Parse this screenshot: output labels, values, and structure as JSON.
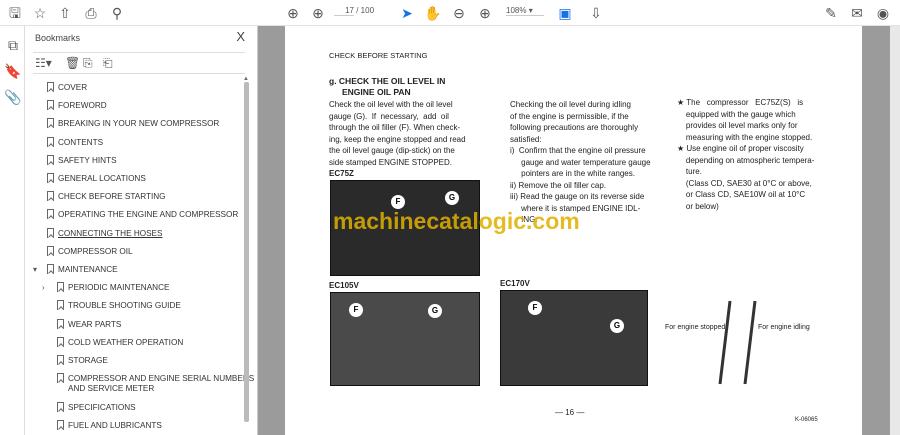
{
  "toolbar": {
    "page_current": "17",
    "page_total": "/ 100",
    "zoom": "108%"
  },
  "panel": {
    "title": "Bookmarks",
    "close": "X"
  },
  "bookmarks": [
    {
      "label": "COVER"
    },
    {
      "label": "FOREWORD"
    },
    {
      "label": "BREAKING IN YOUR NEW COMPRESSOR"
    },
    {
      "label": "CONTENTS"
    },
    {
      "label": "SAFETY HINTS"
    },
    {
      "label": "GENERAL LOCATIONS"
    },
    {
      "label": "CHECK BEFORE STARTING"
    },
    {
      "label": "OPERATING THE ENGINE AND COMPRESSOR"
    },
    {
      "label": "CONNECTING THE HOSES"
    },
    {
      "label": "COMPRESSOR OIL"
    },
    {
      "label": "MAINTENANCE"
    },
    {
      "label": "PERIODIC MAINTENANCE"
    },
    {
      "label": "TROUBLE SHOOTING GUIDE"
    },
    {
      "label": "WEAR PARTS"
    },
    {
      "label": "COLD WEATHER OPERATION"
    },
    {
      "label": "STORAGE"
    },
    {
      "label": "COMPRESSOR AND ENGINE SERIAL NUMBERS"
    },
    {
      "label": "AND SERVICE METER"
    },
    {
      "label": "SPECIFICATIONS"
    },
    {
      "label": "FUEL AND LUBRICANTS"
    }
  ],
  "doc": {
    "header": "CHECK BEFORE STARTING",
    "heading1": "g.  CHECK THE OIL LEVEL IN",
    "heading2": "ENGINE OIL PAN",
    "col1": [
      "Check the oil level with the oil level",
      "gauge (G).  If  necessary,  add  oil",
      "through the oil filler (F). When check-",
      "ing, keep the engine stopped and read",
      "the oil level gauge (dip-stick) on the",
      "side stamped ENGINE STOPPED."
    ],
    "col2": [
      "Checking the oil level during idling",
      "of the engine is permissible, if the",
      "following precautions are thoroughly",
      "satisfied:",
      "i)  Confirm that the engine oil pressure",
      "     gauge and water temperature gauge",
      "     pointers are in the white ranges.",
      "ii) Remove the oil filler cap.",
      "iii) Read the gauge on its reverse side",
      "     where it is stamped ENGINE IDL-",
      "     ING."
    ],
    "col3": [
      "★ The   compressor   EC75Z(S)   is",
      "    equipped with the gauge which",
      "    provides oil level marks only for",
      "    measuring with the engine stopped.",
      "★ Use engine oil of proper viscosity",
      "    depending on atmospheric tempera-",
      "    ture.",
      "    (Class CD, SAE30 at 0°C or above,",
      "    or Class CD, SAE10W oil at 10°C",
      "    or below)"
    ],
    "fig1": "EC75Z",
    "fig2": "EC105V",
    "fig3": "EC170V",
    "label_f": "F",
    "label_g": "G",
    "stopped": "For engine stopped",
    "idling": "For engine idling",
    "page_no": "— 16 —",
    "code": "K-06065",
    "watermark": "machinecatalogic.com"
  }
}
